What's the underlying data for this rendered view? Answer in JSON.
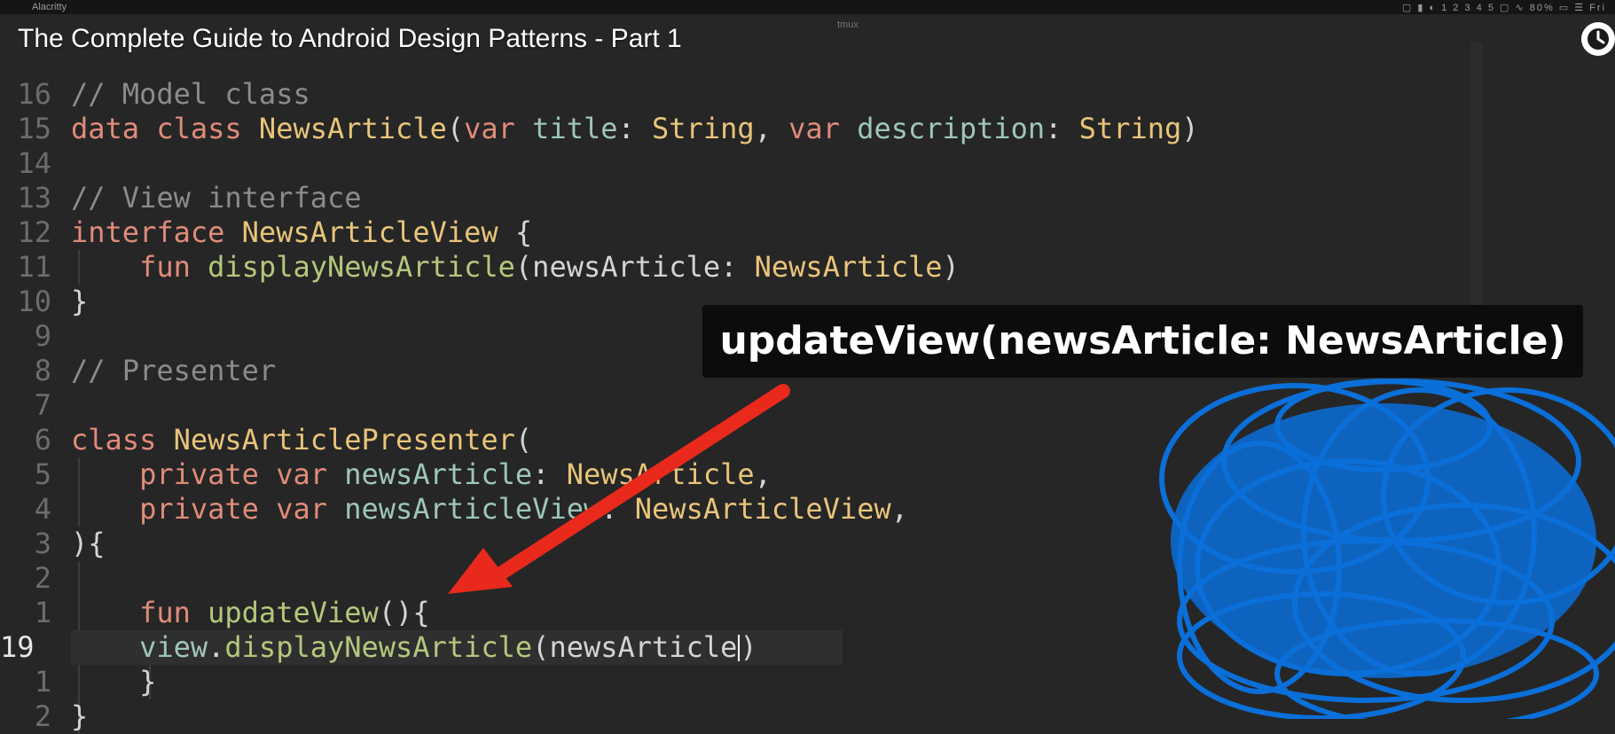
{
  "menubar": {
    "app_name": "Alacritty",
    "center_label": "tmux",
    "tray_text": "▢ ▮ ◐ 1 2 3 4 5 ▢ ∿ 80% ▭ ☰ Fri"
  },
  "video": {
    "title": "The Complete Guide to Android Design Patterns - Part 1"
  },
  "overlay": {
    "tooltip_text": "updateView(newsArticle:  NewsArticle)"
  },
  "editor": {
    "lines": [
      {
        "num": "16",
        "code": [
          {
            "c": "// Model class",
            "cls": "c"
          }
        ]
      },
      {
        "num": "15",
        "code": [
          {
            "c": "data class ",
            "cls": "k"
          },
          {
            "c": "NewsArticle",
            "cls": "t"
          },
          {
            "c": "(",
            "cls": "p"
          },
          {
            "c": "var ",
            "cls": "k"
          },
          {
            "c": "title",
            "cls": "v"
          },
          {
            "c": ": ",
            "cls": "p"
          },
          {
            "c": "String",
            "cls": "t"
          },
          {
            "c": ", ",
            "cls": "p"
          },
          {
            "c": "var ",
            "cls": "k"
          },
          {
            "c": "description",
            "cls": "v"
          },
          {
            "c": ": ",
            "cls": "p"
          },
          {
            "c": "String",
            "cls": "t"
          },
          {
            "c": ")",
            "cls": "p"
          }
        ]
      },
      {
        "num": "14",
        "code": []
      },
      {
        "num": "13",
        "code": [
          {
            "c": "// View interface",
            "cls": "c"
          }
        ]
      },
      {
        "num": "12",
        "code": [
          {
            "c": "interface ",
            "cls": "k"
          },
          {
            "c": "NewsArticleView",
            "cls": "t"
          },
          {
            "c": " {",
            "cls": "p"
          }
        ]
      },
      {
        "num": "11",
        "code": [
          {
            "c": "    fun ",
            "cls": "k"
          },
          {
            "c": "displayNewsArticle",
            "cls": "f"
          },
          {
            "c": "(",
            "cls": "p"
          },
          {
            "c": "newsArticle",
            "cls": "p"
          },
          {
            "c": ": ",
            "cls": "p"
          },
          {
            "c": "NewsArticle",
            "cls": "t"
          },
          {
            "c": ")",
            "cls": "p"
          }
        ]
      },
      {
        "num": "10",
        "code": [
          {
            "c": "}",
            "cls": "p"
          }
        ]
      },
      {
        "num": "9",
        "code": []
      },
      {
        "num": "8",
        "code": [
          {
            "c": "// Presenter",
            "cls": "c"
          }
        ]
      },
      {
        "num": "7",
        "code": []
      },
      {
        "num": "6",
        "code": [
          {
            "c": "class ",
            "cls": "k"
          },
          {
            "c": "NewsArticlePresenter",
            "cls": "t"
          },
          {
            "c": "(",
            "cls": "p"
          }
        ]
      },
      {
        "num": "5",
        "code": [
          {
            "c": "    private var ",
            "cls": "k"
          },
          {
            "c": "newsArticle",
            "cls": "v"
          },
          {
            "c": ": ",
            "cls": "p"
          },
          {
            "c": "NewsArticle",
            "cls": "t"
          },
          {
            "c": ",",
            "cls": "p"
          }
        ]
      },
      {
        "num": "4",
        "code": [
          {
            "c": "    private var ",
            "cls": "k"
          },
          {
            "c": "newsArticleView",
            "cls": "v"
          },
          {
            "c": ": ",
            "cls": "p"
          },
          {
            "c": "NewsArticleView",
            "cls": "t"
          },
          {
            "c": ",",
            "cls": "p"
          }
        ]
      },
      {
        "num": "3",
        "code": [
          {
            "c": "){",
            "cls": "p"
          }
        ]
      },
      {
        "num": "2",
        "code": []
      },
      {
        "num": "1",
        "code": [
          {
            "c": "    fun ",
            "cls": "k"
          },
          {
            "c": "updateView",
            "cls": "f"
          },
          {
            "c": "(){",
            "cls": "p"
          }
        ]
      },
      {
        "num": "19",
        "current": true,
        "code": [
          {
            "c": "    view",
            "cls": "v"
          },
          {
            "c": ".",
            "cls": "p"
          },
          {
            "c": "displayNewsArticle",
            "cls": "f"
          },
          {
            "c": "(",
            "cls": "p"
          },
          {
            "c": "newsArticle",
            "cls": "p"
          },
          {
            "c": "|cursor|",
            "cls": "cursor"
          },
          {
            "c": ")",
            "cls": "p"
          }
        ]
      },
      {
        "num": "1",
        "code": [
          {
            "c": "    }",
            "cls": "p"
          }
        ]
      },
      {
        "num": "2",
        "code": [
          {
            "c": "}",
            "cls": "p"
          }
        ]
      }
    ]
  },
  "colors": {
    "background": "#262626",
    "arrow": "#e8291c",
    "scribble": "#0a6fd9",
    "tooltip_bg": "#0c0c0c"
  },
  "icons": {
    "clock": "clock-icon",
    "arrow": "red-arrow-annotation",
    "scribble": "blue-scribble-annotation"
  }
}
